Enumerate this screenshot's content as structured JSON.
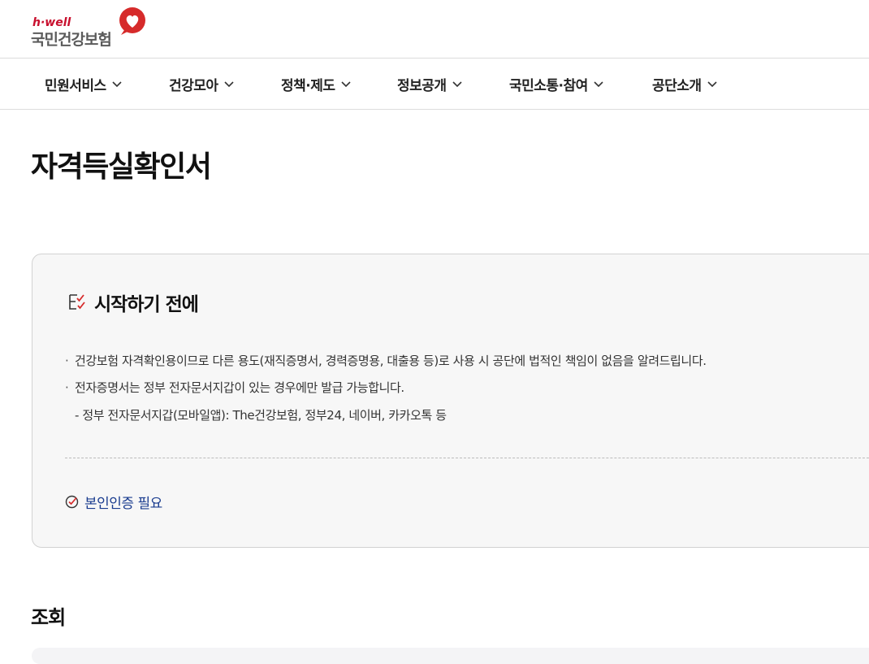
{
  "header": {
    "logo_sub": "h·well",
    "logo_main": "국민건강보험",
    "brand_color": "#c8102e"
  },
  "gnb": {
    "items": [
      {
        "label": "민원서비스",
        "icon": "chevron-down-icon"
      },
      {
        "label": "건강모아",
        "icon": "chevron-down-icon"
      },
      {
        "label": "정책·제도",
        "icon": "chevron-down-icon"
      },
      {
        "label": "정보공개",
        "icon": "chevron-down-icon"
      },
      {
        "label": "국민소통·참여",
        "icon": "chevron-down-icon"
      },
      {
        "label": "공단소개",
        "icon": "chevron-down-icon"
      }
    ]
  },
  "page": {
    "title": "자격득실확인서"
  },
  "before_start": {
    "title": "시작하기 전에",
    "icon": "checklist-icon",
    "notices": [
      "건강보험 자격확인용이므로 다른 용도(재직증명서, 경력증명용, 대출용 등)로 사용 시 공단에 법적인 책임이 없음을 알려드립니다.",
      "전자증명서는 정부 전자문서지갑이 있는 경우에만 발급 가능합니다."
    ],
    "sub_notice": "- 정부 전자문서지갑(모바일앱): The건강보험, 정부24, 네이버, 카카오톡 등",
    "auth_label": "본인인증 필요",
    "auth_icon": "check-circle-icon",
    "auth_color": "#1a3c8f"
  },
  "inquiry": {
    "title": "조회"
  }
}
